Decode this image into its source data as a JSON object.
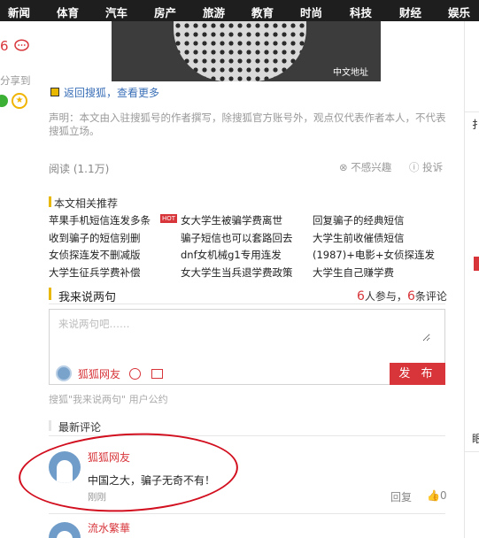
{
  "nav": [
    "新闻",
    "体育",
    "汽车",
    "房产",
    "旅游",
    "教育",
    "时尚",
    "科技",
    "财经",
    "娱乐"
  ],
  "left": {
    "comment_count": "6",
    "share_label": "分享到"
  },
  "image": {
    "watermark": "中文地址"
  },
  "back_link": "返回搜狐，查看更多",
  "disclaimer": "声明：本文由入驻搜狐号的作者撰写，除搜狐官方账号外，观点仅代表作者本人，不代表搜狐立场。",
  "meta": {
    "reads": "阅读 (1.1万)",
    "not_interested": "不感兴趣",
    "complain": "投诉"
  },
  "related": {
    "title": "本文相关推荐",
    "hot_badge": "HOT",
    "items": [
      [
        "苹果手机短信连发多条",
        "女大学生被骗学费离世",
        "回复骗子的经典短信"
      ],
      [
        "收到骗子的短信别删",
        "骗子短信也可以套路回去",
        "大学生前收催债短信"
      ],
      [
        "女侦探连发不删减版",
        "dnf女机械g1专用连发",
        "(1987)+电影+女侦探连发"
      ],
      [
        "大学生征兵学费补偿",
        "女大学生当兵退学费政策",
        "大学生自己赚学费"
      ]
    ]
  },
  "comment_section": {
    "title": "我来说两句",
    "participants": "6",
    "participants_label": "人参与，",
    "comments": "6",
    "comments_label": "条评论",
    "placeholder": "来说两句吧……",
    "username": "狐狐网友",
    "publish": "发 布",
    "policy": "搜狐\"我来说两句\" 用户公约"
  },
  "latest": {
    "title": "最新评论",
    "items": [
      {
        "user": "狐狐网友",
        "text": "中国之大，骗子无奇不有！",
        "time": "刚刚",
        "reply": "回复",
        "likes": "0"
      },
      {
        "user": "流水繁華"
      }
    ]
  },
  "right": {
    "chars": [
      "扌",
      "眼"
    ]
  },
  "colors": {
    "brand_red": "#d7353a",
    "accent_yellow": "#e8b800",
    "nav_bg": "#1e1e1e",
    "annotation_red": "#d20f1f"
  }
}
